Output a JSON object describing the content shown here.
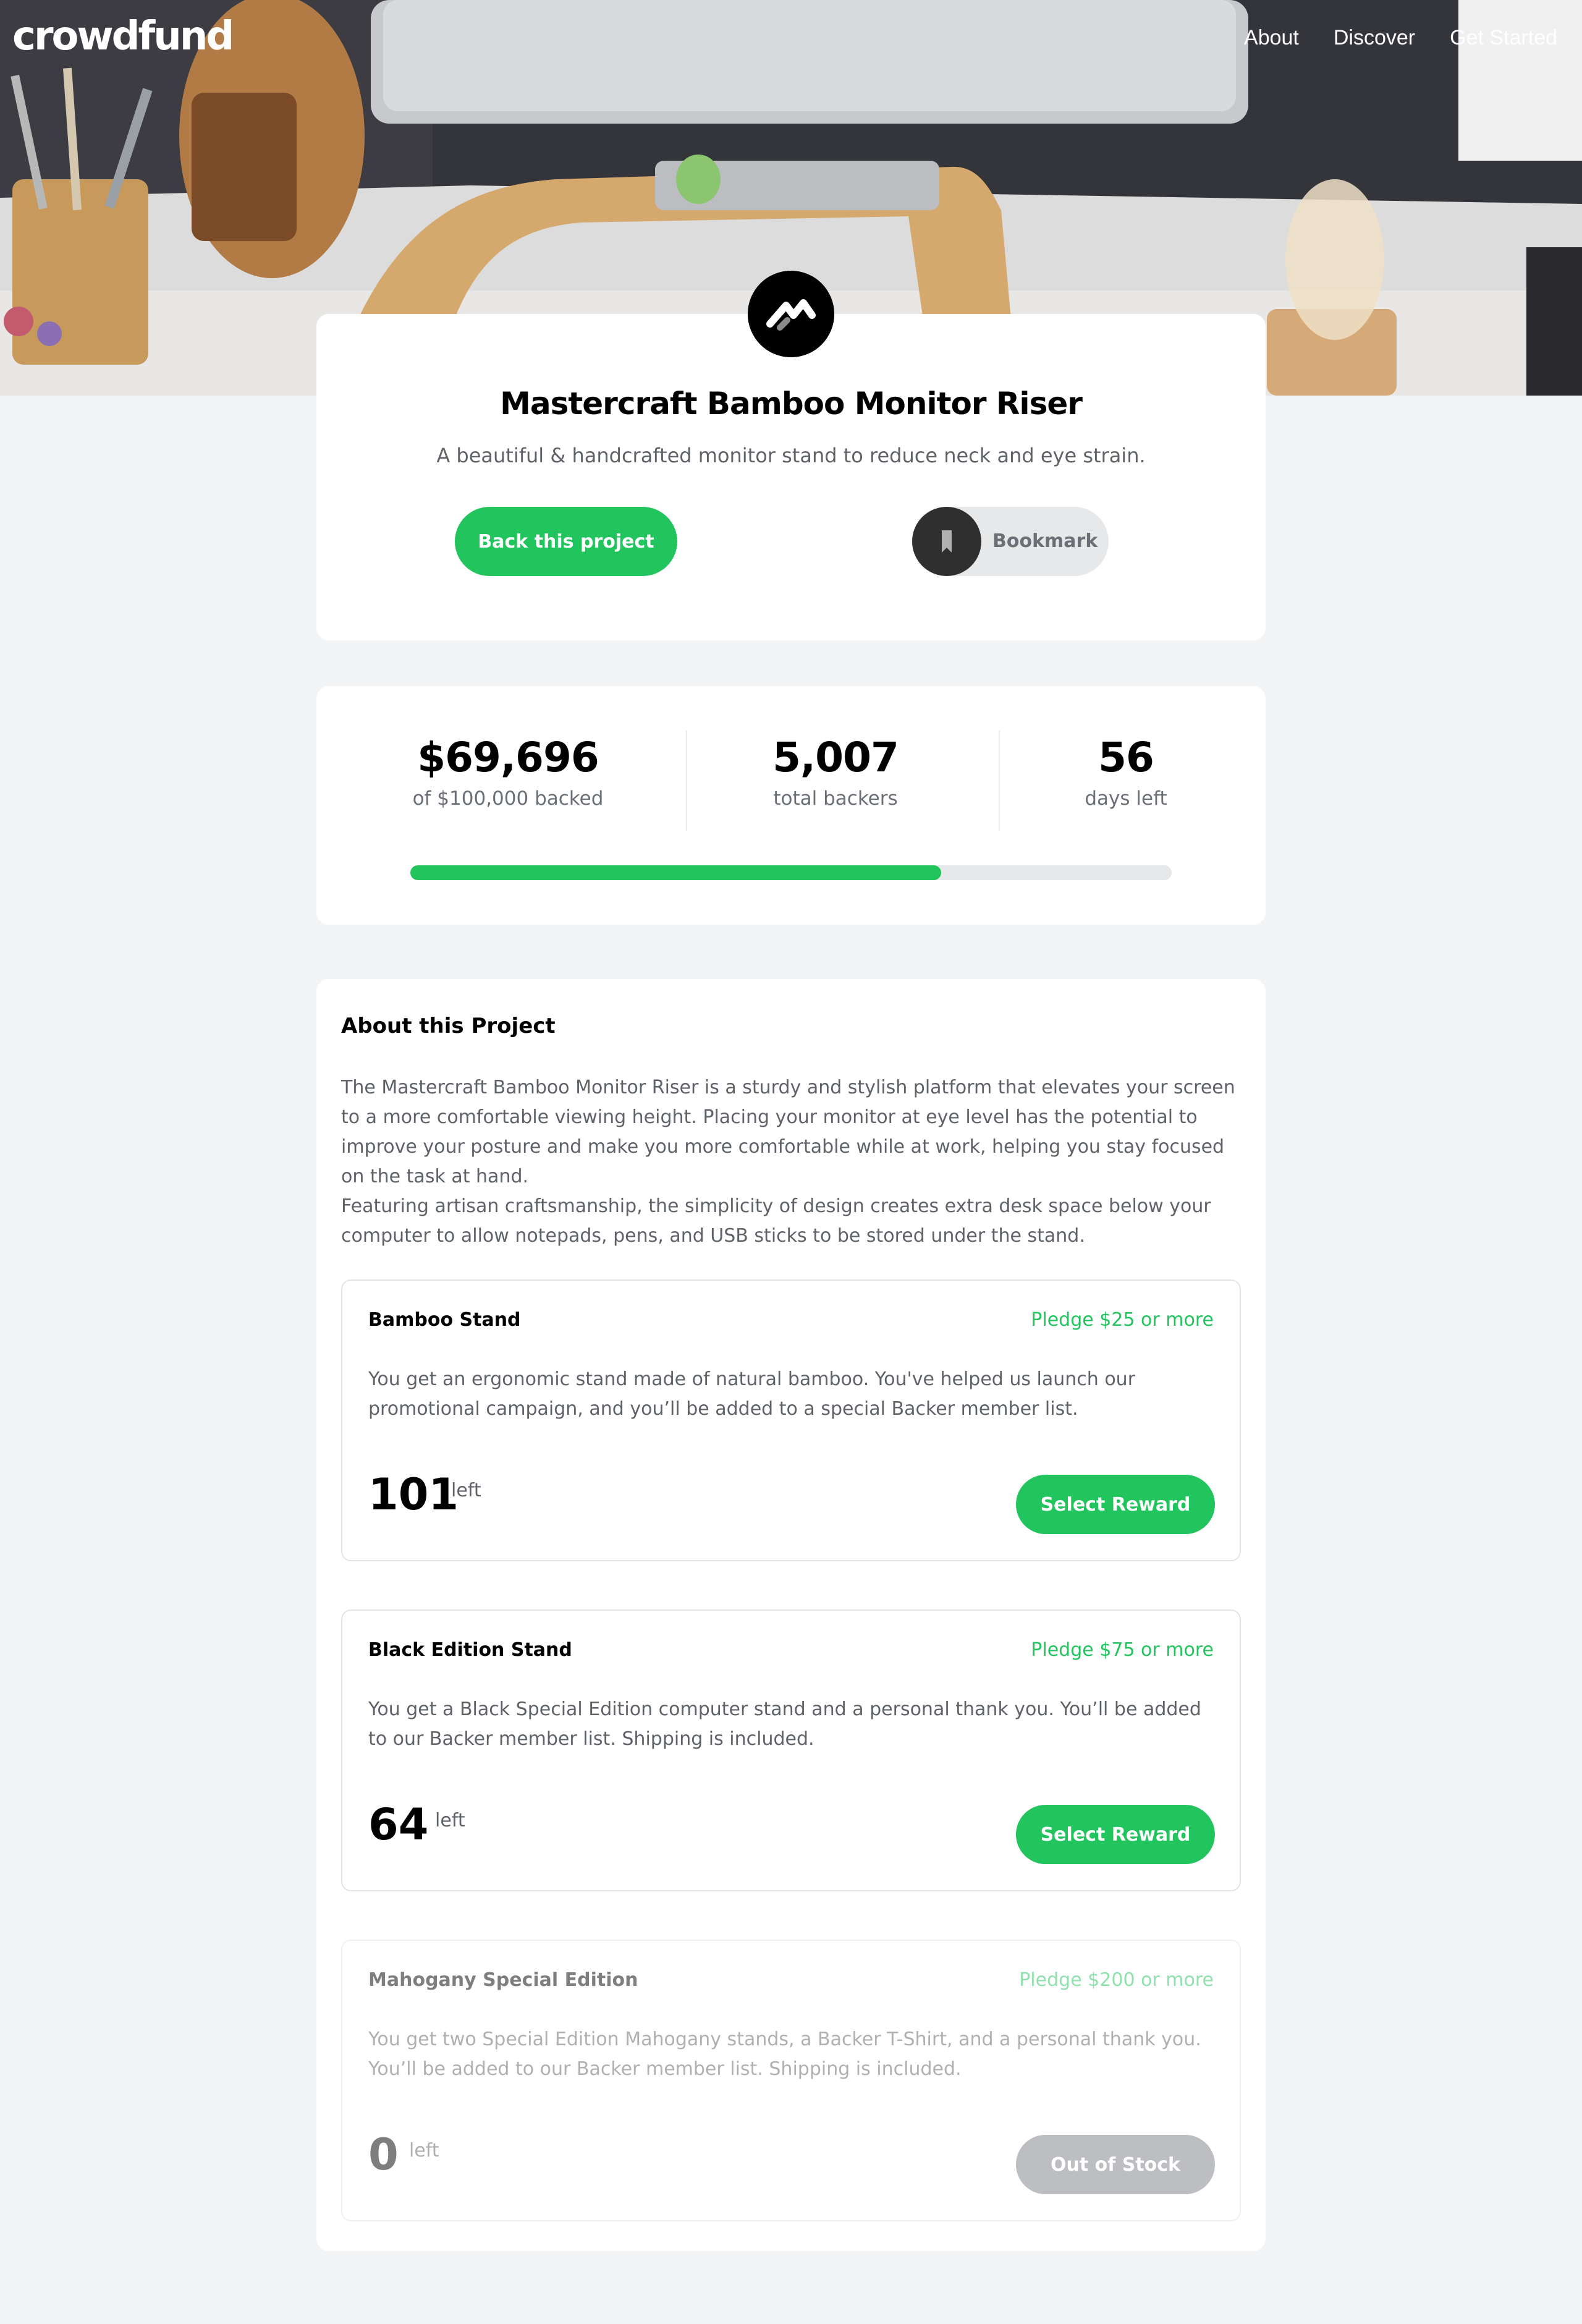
{
  "header": {
    "logo": "crowdfund",
    "nav": [
      "About",
      "Discover",
      "Get Started"
    ]
  },
  "project": {
    "title": "Mastercraft Bamboo Monitor Riser",
    "subtitle": "A beautiful & handcrafted monitor stand to reduce neck and eye strain.",
    "back_button": "Back this project",
    "bookmark_button": "Bookmark"
  },
  "stats": {
    "backed": {
      "value": "$69,696",
      "label": "of $100,000 backed"
    },
    "backers": {
      "value": "5,007",
      "label": "total backers"
    },
    "days": {
      "value": "56",
      "label": "days left"
    },
    "progress_fraction": 0.69696
  },
  "about": {
    "title": "About this Project",
    "paragraphs": [
      "The Mastercraft Bamboo Monitor Riser is a sturdy and stylish platform that elevates your screen to a more comfortable viewing height. Placing your monitor at eye level has the potential to improve your posture and make you more comfortable while at work, helping you stay focused on the task at hand.",
      "Featuring artisan craftsmanship, the simplicity of design creates extra desk space below your computer to allow notepads, pens, and USB sticks to be stored under the stand."
    ]
  },
  "rewards": [
    {
      "name": "Bamboo Stand",
      "pledge": "Pledge $25 or more",
      "description": "You get an ergonomic stand made of natural bamboo. You've helped us launch our promotional campaign, and you’ll be added to a special Backer member list.",
      "count": "101",
      "left_label": "left",
      "button": "Select Reward"
    },
    {
      "name": "Black Edition Stand",
      "pledge": "Pledge $75 or more",
      "description": "You get a Black Special Edition computer stand and a personal thank you. You’ll be added to our Backer member list. Shipping is included.",
      "count": "64",
      "left_label": "left",
      "button": "Select Reward"
    },
    {
      "name": "Mahogany Special Edition",
      "pledge": "Pledge $200 or more",
      "description": "You get two Special Edition Mahogany stands, a Backer T-Shirt, and a personal thank you. You’ll be added to our Backer member list. Shipping is included.",
      "count": "0",
      "left_label": "left",
      "button": "Out of Stock"
    }
  ],
  "colors": {
    "accent": "#21c45d",
    "text_muted": "#5f6368",
    "background": "#f3f4f6",
    "disabled_button": "#7c7f87"
  }
}
